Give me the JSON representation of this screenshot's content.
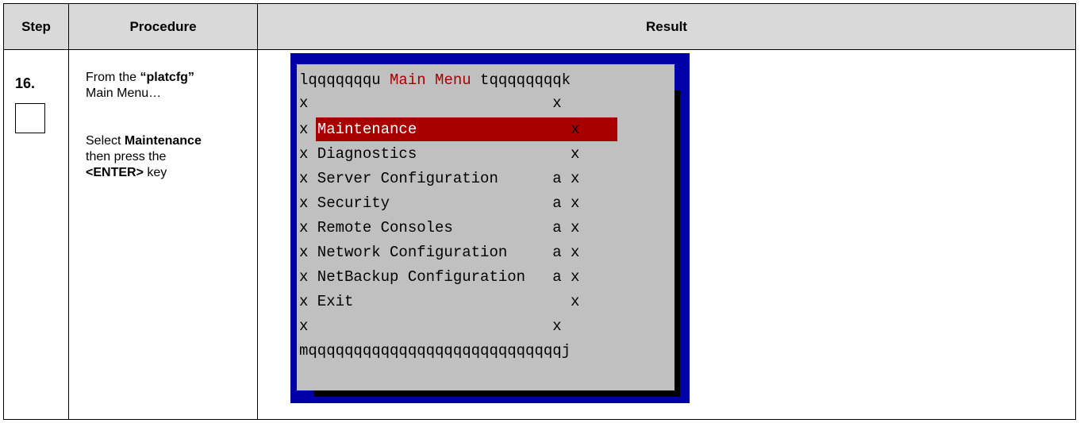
{
  "table": {
    "headers": {
      "step": "Step",
      "procedure": "Procedure",
      "result": "Result"
    }
  },
  "row": {
    "step_number": "16.",
    "procedure": {
      "line1_prefix": "From the ",
      "line1_bold": "“platcfg”",
      "line2": "Main Menu…",
      "select_prefix": "Select ",
      "select_bold": "Maintenance",
      "then": "then press the",
      "key_bold": "<ENTER>",
      "key_suffix": " key"
    }
  },
  "terminal": {
    "top_left": "lqqqqqqqu ",
    "title": "Main Menu",
    "top_right": " tqqqqqqqqk",
    "empty_line": "x                           x",
    "selected_item": "Maintenance",
    "items": [
      "x Diagnostics                 x",
      "x Server Configuration      a x",
      "x Security                  a x",
      "x Remote Consoles           a x",
      "x Network Configuration     a x",
      "x NetBackup Configuration   a x",
      "x Exit                        x"
    ],
    "bottom": "mqqqqqqqqqqqqqqqqqqqqqqqqqqqqj",
    "colors": {
      "frame": "#0000a8",
      "menu_bg": "#c0c0c0",
      "highlight": "#a80000",
      "title": "#a80000"
    }
  }
}
